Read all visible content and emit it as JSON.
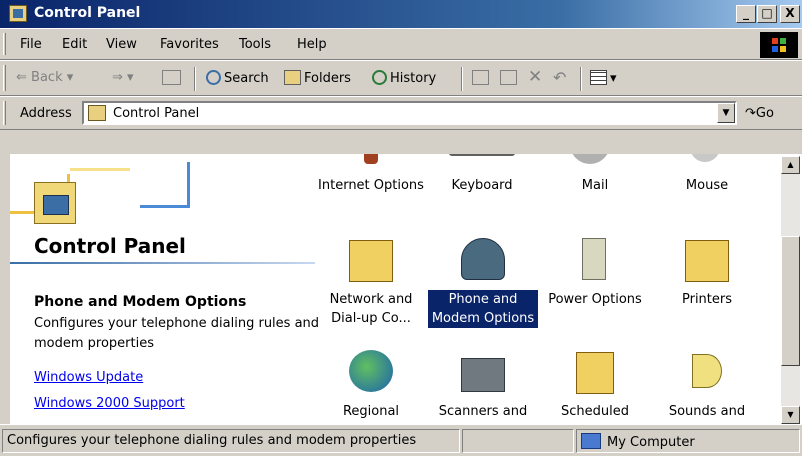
{
  "window": {
    "title": "Control Panel",
    "buttons": {
      "minimize": "_",
      "maximize": "□",
      "close": "X"
    }
  },
  "menubar": {
    "items": [
      "File",
      "Edit",
      "View",
      "Favorites",
      "Tools",
      "Help"
    ]
  },
  "toolbar": {
    "back": "Back",
    "search": "Search",
    "folders": "Folders",
    "history": "History"
  },
  "address": {
    "label": "Address",
    "value": "Control Panel",
    "go": "Go"
  },
  "leftpane": {
    "title": "Control Panel",
    "selected_title": "Phone and Modem Options",
    "selected_desc": "Configures your telephone dialing rules and modem properties",
    "links": [
      "Windows Update",
      "Windows 2000 Support"
    ]
  },
  "icons": [
    {
      "label": "Internet Options",
      "icon": "internet-options-icon"
    },
    {
      "label": "Keyboard",
      "icon": "keyboard-icon"
    },
    {
      "label": "Mail",
      "icon": "mail-icon"
    },
    {
      "label": "Mouse",
      "icon": "mouse-icon"
    },
    {
      "label": "Network and Dial-up Co...",
      "icon": "network-icon"
    },
    {
      "label": "Phone and Modem Options",
      "icon": "phone-modem-icon",
      "selected": true
    },
    {
      "label": "Power Options",
      "icon": "power-icon"
    },
    {
      "label": "Printers",
      "icon": "printers-icon"
    },
    {
      "label": "Regional",
      "icon": "regional-icon"
    },
    {
      "label": "Scanners and",
      "icon": "scanner-icon"
    },
    {
      "label": "Scheduled",
      "icon": "scheduled-icon"
    },
    {
      "label": "Sounds and",
      "icon": "sounds-icon"
    }
  ],
  "statusbar": {
    "text": "Configures your telephone dialing rules and modem properties",
    "zone": "My Computer"
  },
  "colors": {
    "title_bar": "#0a246a",
    "selection": "#0a246a",
    "link": "#0000ee"
  }
}
